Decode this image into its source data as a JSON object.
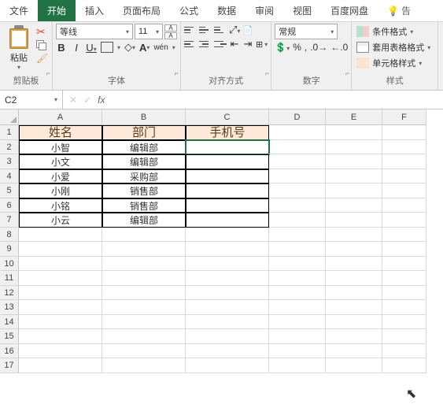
{
  "tabs": {
    "file": "文件",
    "home": "开始",
    "insert": "插入",
    "layout": "页面布局",
    "formula": "公式",
    "data": "数据",
    "review": "审阅",
    "view": "视图",
    "baidu": "百度网盘",
    "tell": "告"
  },
  "ribbon": {
    "clipboard": {
      "paste": "粘贴",
      "label": "剪贴板"
    },
    "font": {
      "name": "等线",
      "size": "11",
      "label": "字体",
      "wen": "wén"
    },
    "align": {
      "label": "对齐方式"
    },
    "number": {
      "format": "常规",
      "label": "数字"
    },
    "styles": {
      "cond": "条件格式",
      "table": "套用表格格式",
      "cell": "单元格样式",
      "label": "样式"
    }
  },
  "namebox": "C2",
  "cols": [
    "A",
    "B",
    "C",
    "D",
    "E",
    "F"
  ],
  "rows": [
    "1",
    "2",
    "3",
    "4",
    "5",
    "6",
    "7",
    "8",
    "9",
    "10",
    "11",
    "12",
    "13",
    "14",
    "15",
    "16",
    "17"
  ],
  "headers": {
    "a": "姓名",
    "b": "部门",
    "c": "手机号"
  },
  "data": [
    {
      "a": "小智",
      "b": "编辑部"
    },
    {
      "a": "小文",
      "b": "编辑部"
    },
    {
      "a": "小爱",
      "b": "采购部"
    },
    {
      "a": "小刚",
      "b": "销售部"
    },
    {
      "a": "小铭",
      "b": "销售部"
    },
    {
      "a": "小云",
      "b": "编辑部"
    }
  ]
}
